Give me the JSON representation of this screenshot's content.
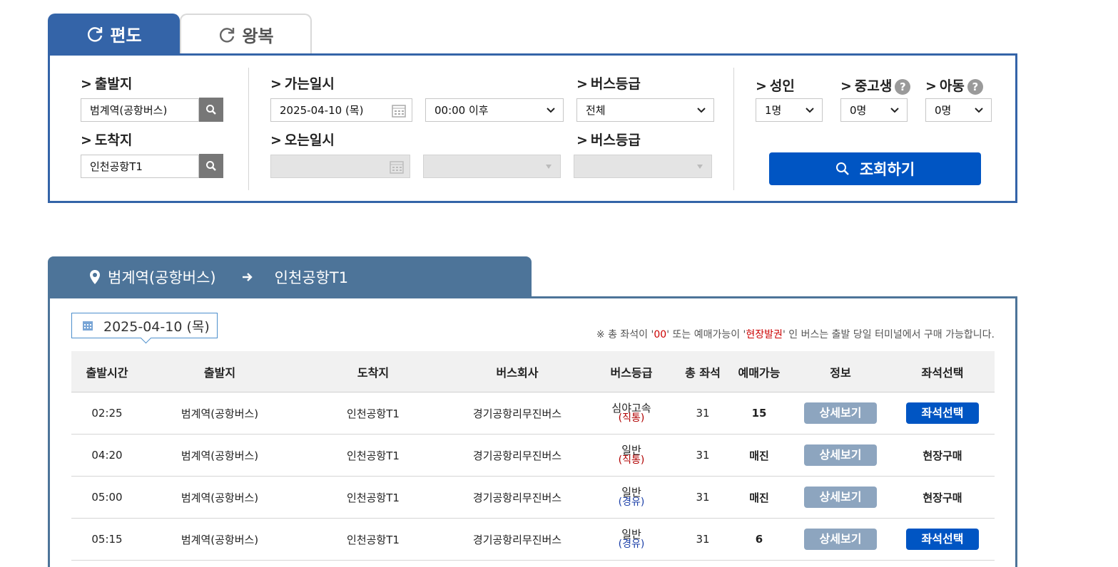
{
  "tabs": {
    "one_way": "편도",
    "round_trip": "왕복"
  },
  "search": {
    "departure_label": "출발지",
    "departure_value": "범계역(공항버스)",
    "arrival_label": "도착지",
    "arrival_value": "인천공항T1",
    "go_date_label": "가는일시",
    "go_date_value": "2025-04-10 (목)",
    "go_time_value": "00:00 이후",
    "bus_grade_label": "버스등급",
    "bus_grade_value": "전체",
    "return_date_label": "오는일시",
    "return_bus_grade_label": "버스등급",
    "adult_label": "성인",
    "adult_value": "1명",
    "youth_label": "중고생",
    "youth_value": "0명",
    "child_label": "아동",
    "child_value": "0명",
    "help_mark": "?",
    "query_button": "조회하기"
  },
  "route": {
    "from": "범계역(공항버스)",
    "to": "인천공항T1",
    "date": "2025-04-10 (목)"
  },
  "notice": {
    "p1": "※ 총 좌석이 '",
    "r1": "00",
    "p2": "' 또는 예매가능이 '",
    "r2": "현장발권",
    "p3": "' 인 버스는 출발 당일 터미널에서 구매 가능합니다."
  },
  "table": {
    "headers": [
      "출발시간",
      "출발지",
      "도착지",
      "버스회사",
      "버스등급",
      "총 좌석",
      "예매가능",
      "정보",
      "좌석선택"
    ],
    "rows": [
      {
        "time": "02:25",
        "from": "범계역(공항버스)",
        "to": "인천공항T1",
        "company": "경기공항리무진버스",
        "grade": "심야고속",
        "grade_sub": "(직통)",
        "sub_color": "red",
        "seats": "31",
        "avail": "15",
        "info": "상세보기",
        "select": "좌석선택",
        "select_type": "button"
      },
      {
        "time": "04:20",
        "from": "범계역(공항버스)",
        "to": "인천공항T1",
        "company": "경기공항리무진버스",
        "grade": "일반",
        "grade_sub": "(직통)",
        "sub_color": "red",
        "seats": "31",
        "avail": "매진",
        "info": "상세보기",
        "select": "현장구매",
        "select_type": "text"
      },
      {
        "time": "05:00",
        "from": "범계역(공항버스)",
        "to": "인천공항T1",
        "company": "경기공항리무진버스",
        "grade": "일반",
        "grade_sub": "(경유)",
        "sub_color": "blue",
        "seats": "31",
        "avail": "매진",
        "info": "상세보기",
        "select": "현장구매",
        "select_type": "text"
      },
      {
        "time": "05:15",
        "from": "범계역(공항버스)",
        "to": "인천공항T1",
        "company": "경기공항리무진버스",
        "grade": "일반",
        "grade_sub": "(경유)",
        "sub_color": "blue",
        "seats": "31",
        "avail": "6",
        "info": "상세보기",
        "select": "좌석선택",
        "select_type": "button"
      }
    ]
  },
  "colors": {
    "tab_active": "#3464a8",
    "route_header": "#4d7499",
    "primary_button": "#0055c3",
    "detail_button": "#8da5bf"
  },
  "icons": [
    "refresh-icon",
    "search-icon",
    "calendar-icon",
    "chevron-down-icon",
    "location-pin-icon",
    "arrow-right-icon",
    "help-icon"
  ]
}
